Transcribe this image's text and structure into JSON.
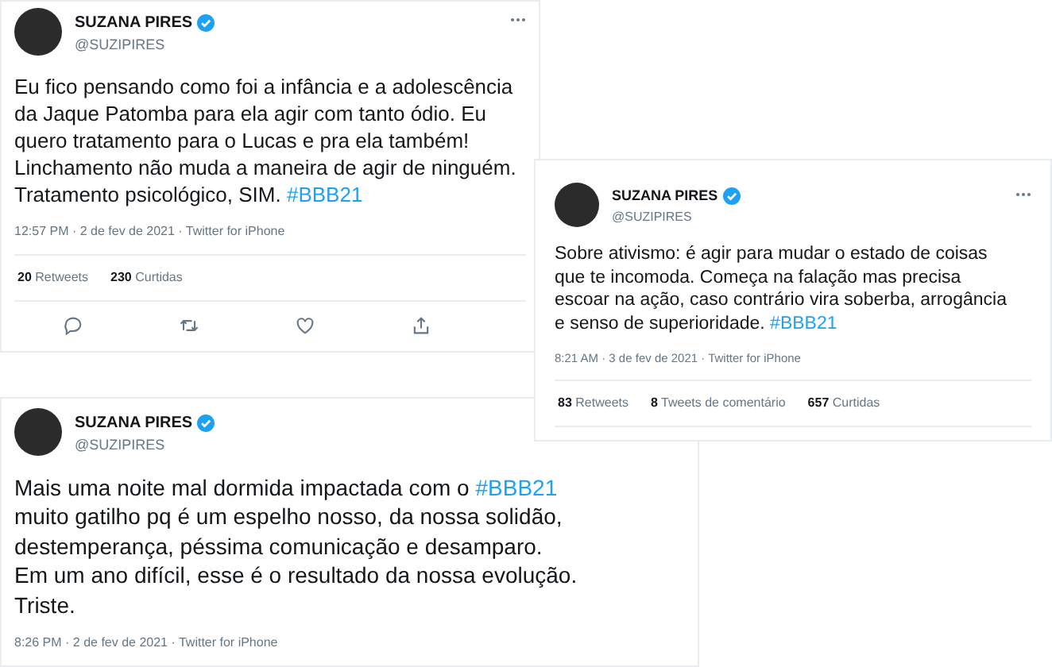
{
  "tweets": [
    {
      "name": "SUZANA PIRES",
      "verified": true,
      "handle": "@SUZIPIRES",
      "has_menu": true,
      "body": [
        {
          "kind": "text",
          "text": "Eu fico pensando como foi a infância e a adolescência\nda Jaque Patomba para ela agir com tanto ódio. Eu\nquero tratamento para o Lucas e pra ela também!\nLinchamento não muda a maneira de agir de ninguém.\nTratamento psicológico, SIM. "
        },
        {
          "kind": "hashtag",
          "text": "#BBB21"
        }
      ],
      "meta": "12:57 PM · 2 de fev de 2021 · Twitter for iPhone",
      "stats": [
        {
          "count": "20",
          "label": "Retweets"
        },
        {
          "count": "230",
          "label": "Curtidas"
        }
      ],
      "actions": [
        {
          "kind": "reply"
        },
        {
          "kind": "retweet"
        },
        {
          "kind": "like"
        },
        {
          "kind": "share"
        }
      ]
    },
    {
      "name": "SUZANA PIRES",
      "verified": true,
      "handle": "@SUZIPIRES",
      "has_menu": false,
      "body": [
        {
          "kind": "text",
          "text": "Mais uma noite mal dormida impactada com o "
        },
        {
          "kind": "hashtag",
          "text": "#BBB21"
        },
        {
          "kind": "text",
          "text": "\nmuito gatilho pq é um espelho nosso, da nossa solidão,\ndestemperança, péssima comunicação e desamparo.\nEm um ano difícil, esse é o resultado da nossa evolução.\nTriste."
        }
      ],
      "meta": "8:26 PM · 2 de fev de 2021 · Twitter for iPhone"
    },
    {
      "name": "SUZANA PIRES",
      "verified": true,
      "handle": "@SUZIPIRES",
      "has_menu": true,
      "body": [
        {
          "kind": "text",
          "text": "Sobre ativismo: é agir para mudar o estado de coisas\nque te incomoda. Começa na falação mas precisa\nescoar na ação, caso contrário vira soberba, arrogância\ne senso de superioridade. "
        },
        {
          "kind": "hashtag",
          "text": "#BBB21"
        }
      ],
      "meta": "8:21 AM · 3 de fev de 2021 · Twitter for iPhone",
      "stats": [
        {
          "count": "83",
          "label": "Retweets"
        },
        {
          "count": "8",
          "label": "Tweets de comentário"
        },
        {
          "count": "657",
          "label": "Curtidas"
        }
      ]
    }
  ]
}
